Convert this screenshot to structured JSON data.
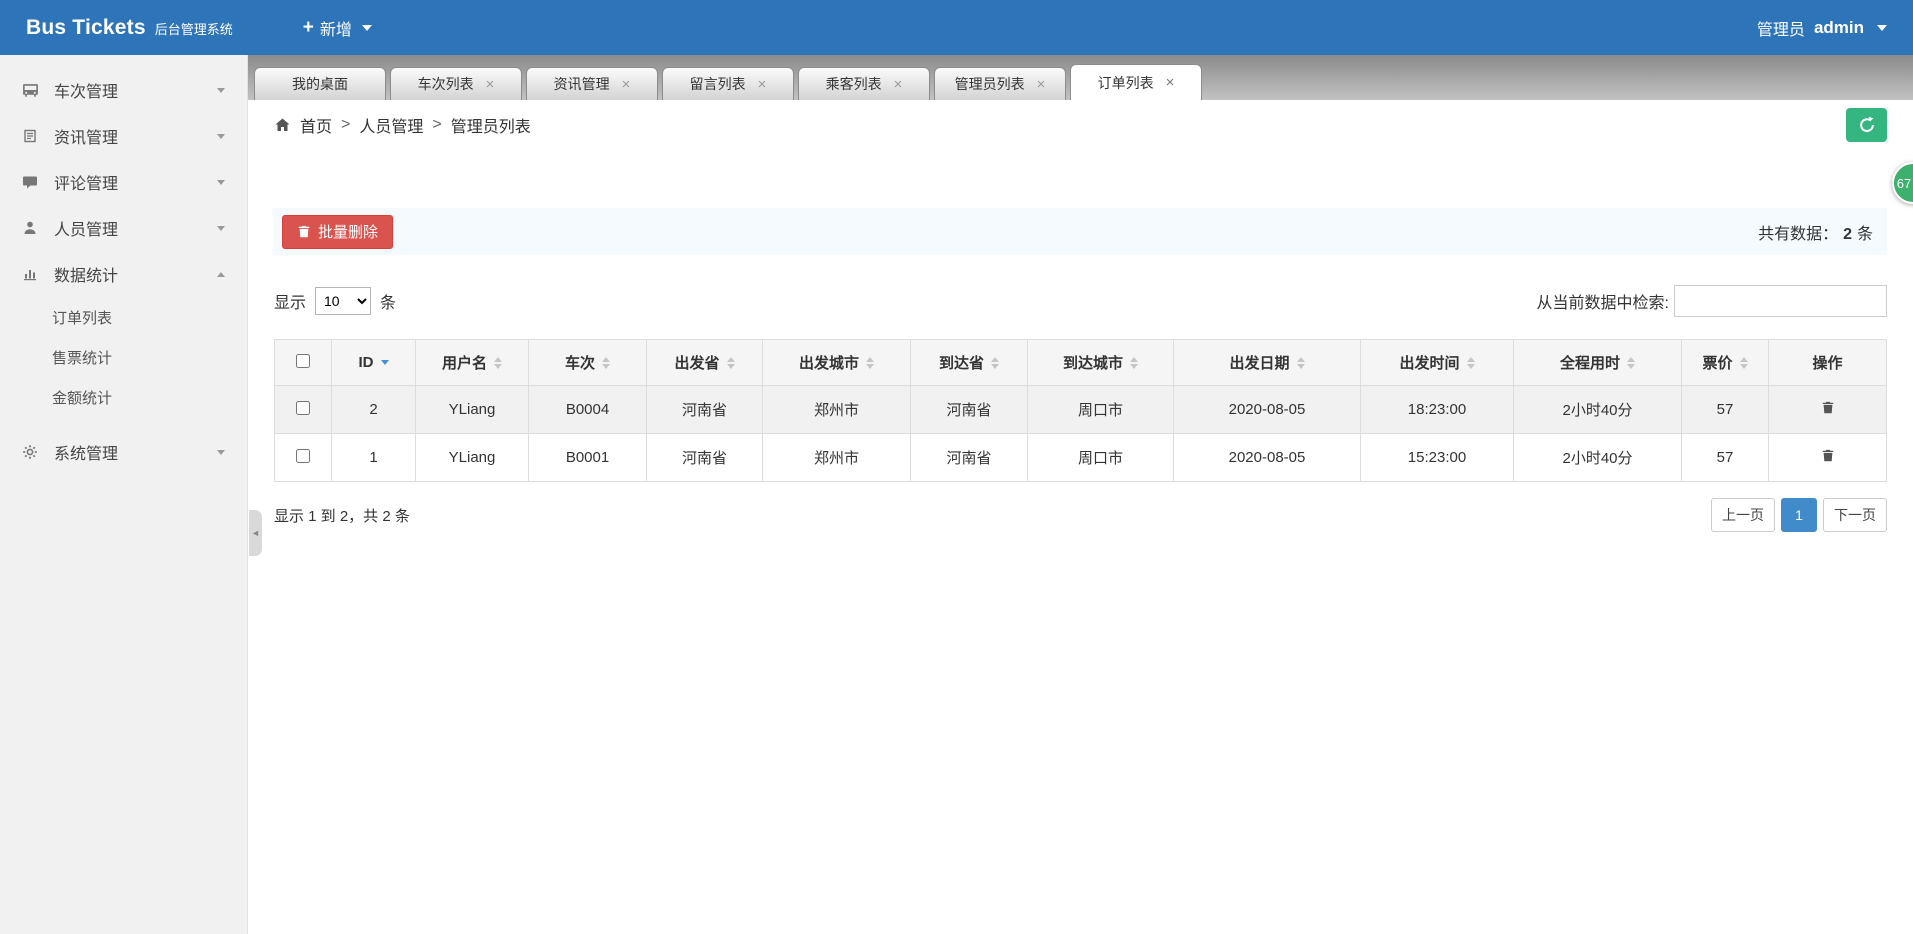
{
  "topbar": {
    "brand": "Bus Tickets",
    "brand_sub": "后台管理系统",
    "add_menu": "新增",
    "user_role": "管理员",
    "user_name": "admin"
  },
  "icons": {
    "plus": "+",
    "close": "×",
    "collapse": "◄"
  },
  "sidebar": {
    "items": [
      {
        "label": "车次管理",
        "icon": "bus-icon"
      },
      {
        "label": "资讯管理",
        "icon": "news-icon"
      },
      {
        "label": "评论管理",
        "icon": "comment-icon"
      },
      {
        "label": "人员管理",
        "icon": "users-icon"
      },
      {
        "label": "数据统计",
        "icon": "stats-icon",
        "expanded": true,
        "children": [
          "订单列表",
          "售票统计",
          "金额统计"
        ]
      },
      {
        "label": "系统管理",
        "icon": "gear-icon"
      }
    ]
  },
  "tabs": [
    {
      "label": "我的桌面"
    },
    {
      "label": "车次列表"
    },
    {
      "label": "资讯管理"
    },
    {
      "label": "留言列表"
    },
    {
      "label": "乘客列表"
    },
    {
      "label": "管理员列表"
    },
    {
      "label": "订单列表",
      "active": true
    }
  ],
  "breadcrumb": {
    "separator": ">",
    "items": [
      "首页",
      "人员管理",
      "管理员列表"
    ]
  },
  "badge": {
    "value": "67"
  },
  "toolbar": {
    "batch_delete_label": "批量删除",
    "total_prefix": "共有数据：",
    "total_count": "2",
    "total_suffix": "条"
  },
  "table_controls": {
    "show_prefix": "显示",
    "page_size": "10",
    "show_suffix": "条",
    "search_label": "从当前数据中检索:",
    "search_value": ""
  },
  "table": {
    "headers": [
      "ID",
      "用户名",
      "车次",
      "出发省",
      "出发城市",
      "到达省",
      "到达城市",
      "出发日期",
      "出发时间",
      "全程用时",
      "票价",
      "操作"
    ],
    "rows": [
      {
        "id": "2",
        "user": "YLiang",
        "train": "B0004",
        "from_prov": "河南省",
        "from_city": "郑州市",
        "to_prov": "河南省",
        "to_city": "周口市",
        "date": "2020-08-05",
        "time": "18:23:00",
        "duration": "2小时40分",
        "price": "57"
      },
      {
        "id": "1",
        "user": "YLiang",
        "train": "B0001",
        "from_prov": "河南省",
        "from_city": "郑州市",
        "to_prov": "河南省",
        "to_city": "周口市",
        "date": "2020-08-05",
        "time": "15:23:00",
        "duration": "2小时40分",
        "price": "57"
      }
    ]
  },
  "pagination": {
    "summary": "显示 1 到 2，共 2 条",
    "prev": "上一页",
    "page": "1",
    "next": "下一页"
  }
}
